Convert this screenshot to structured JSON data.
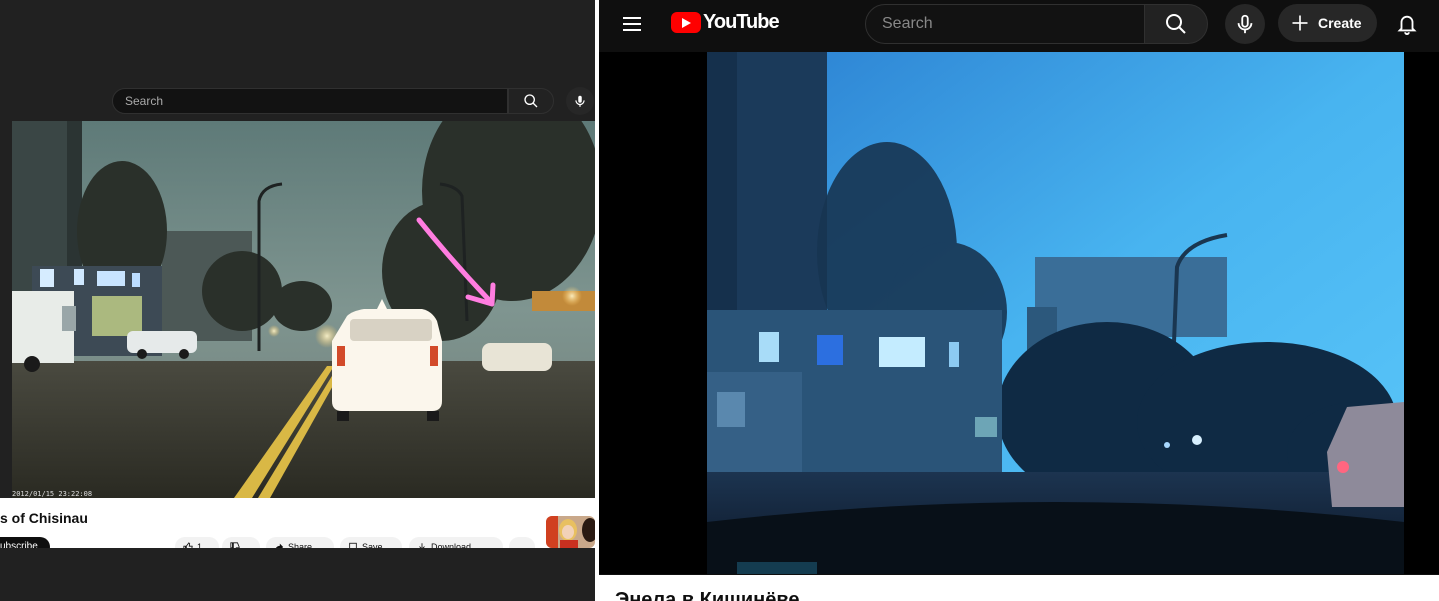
{
  "left": {
    "search": {
      "placeholder": "Search"
    },
    "video": {
      "timestamp": "2012/01/15 23:22:08"
    },
    "title_fragment": "s of Chisinau",
    "subscribe_label": "ubscribe",
    "actions": [
      {
        "name": "like",
        "label": "1"
      },
      {
        "name": "dislike",
        "label": ""
      },
      {
        "name": "share",
        "label": "Share"
      },
      {
        "name": "save",
        "label": "Save"
      },
      {
        "name": "download",
        "label": "Download"
      }
    ]
  },
  "right": {
    "logo_text": "YouTube",
    "search": {
      "placeholder": "Search"
    },
    "create_label": "Create",
    "video_title": "Энела в Кишинёве"
  },
  "colors": {
    "brand_red": "#ff0000",
    "annotation_arrow": "#ff7de0",
    "dark_bg": "#0f0f0f"
  }
}
